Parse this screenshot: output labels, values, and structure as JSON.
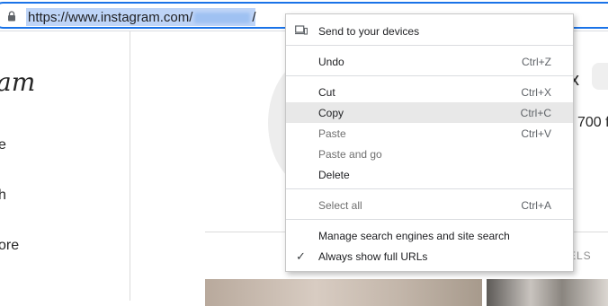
{
  "address_bar": {
    "url_prefix": "https://www.instagram.com/",
    "url_suffix": "/"
  },
  "page": {
    "logo_fragment": "am",
    "nav": [
      "e",
      "h",
      "ore"
    ],
    "stat_fragment": "x",
    "followers_fragment": "700 f",
    "tab_fragment": "ELS"
  },
  "context_menu": {
    "send_to_devices": "Send to your devices",
    "undo": "Undo",
    "undo_shortcut": "Ctrl+Z",
    "cut": "Cut",
    "cut_shortcut": "Ctrl+X",
    "copy": "Copy",
    "copy_shortcut": "Ctrl+C",
    "paste": "Paste",
    "paste_shortcut": "Ctrl+V",
    "paste_and_go": "Paste and go",
    "delete": "Delete",
    "select_all": "Select all",
    "select_all_shortcut": "Ctrl+A",
    "manage_search": "Manage search engines and site search",
    "always_show_urls": "Always show full URLs"
  },
  "colors": {
    "focus_ring": "#1a73e8",
    "selection": "#bed4f7",
    "menu_highlight": "#e8e8e8"
  }
}
